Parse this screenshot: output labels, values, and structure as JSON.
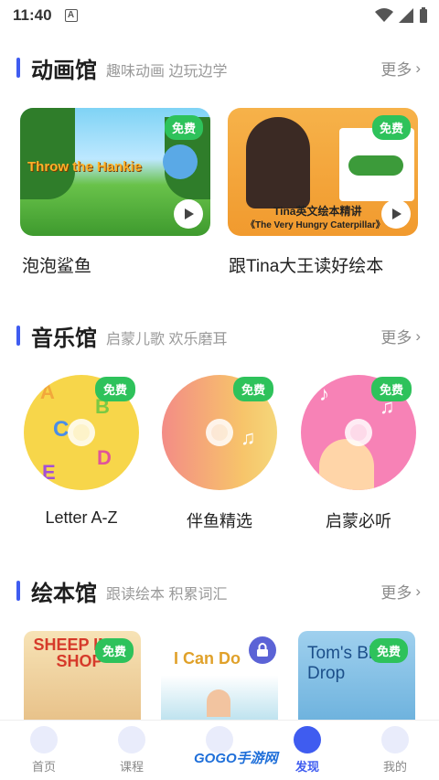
{
  "status": {
    "time": "11:40"
  },
  "sections": {
    "animation": {
      "title": "动画馆",
      "subtitle": "趣味动画 边玩边学",
      "more": "更多"
    },
    "music": {
      "title": "音乐馆",
      "subtitle": "启蒙儿歌 欢乐磨耳",
      "more": "更多"
    },
    "picturebook": {
      "title": "绘本馆",
      "subtitle": "跟读绘本 积累词汇",
      "more": "更多"
    }
  },
  "animation_cards": [
    {
      "label": "泡泡鲨鱼",
      "tag": "免费",
      "art_text": "Throw the Hankie"
    },
    {
      "label": "跟Tina大王读好绘本",
      "tag": "免费",
      "art_text": "Tina英文绘本精讲",
      "art_text2": "《The Very Hungry Caterpillar》"
    }
  ],
  "music_cards": [
    {
      "label": "Letter A-Z",
      "tag": "免费"
    },
    {
      "label": "伴鱼精选",
      "tag": "免费"
    },
    {
      "label": "启蒙必听",
      "tag": "免费"
    }
  ],
  "book_cards": [
    {
      "tag": "免费",
      "art_text": "SHEEP IN A SHOP"
    },
    {
      "art_text": "I Can Do"
    },
    {
      "tag": "免费",
      "art_text": "Tom's Big Drop"
    }
  ],
  "tabbar": [
    {
      "label": "首页"
    },
    {
      "label": "课程"
    },
    {
      "label": ""
    },
    {
      "label": "发现"
    },
    {
      "label": "我的"
    }
  ],
  "watermark": "GOGO手游网",
  "colors": {
    "accent": "#3f5cf0",
    "free_tag": "#2ec25b"
  }
}
